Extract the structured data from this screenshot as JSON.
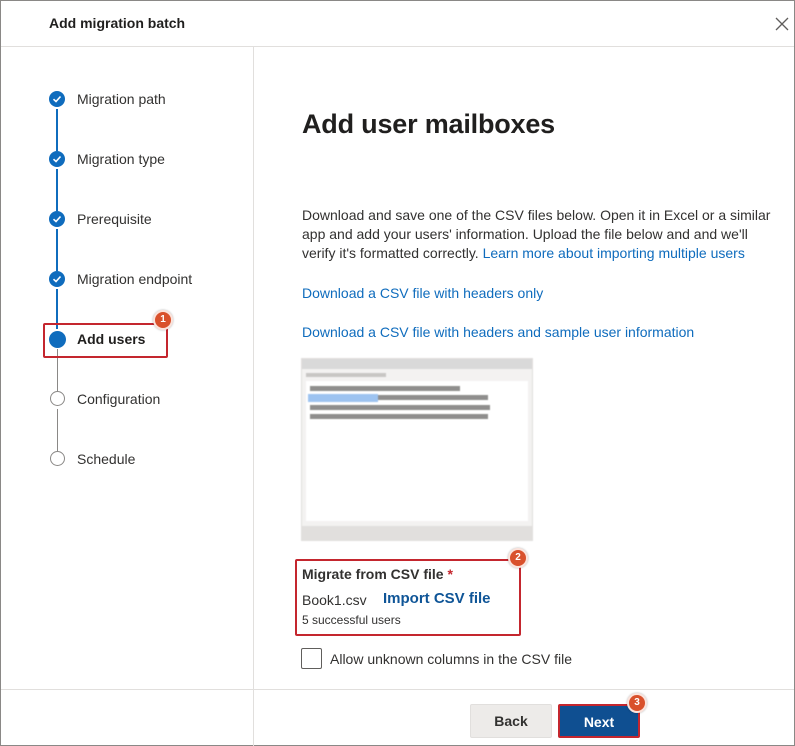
{
  "dialog": {
    "title": "Add migration batch",
    "close_icon": "close-icon"
  },
  "steps": [
    {
      "label": "Migration path",
      "state": "done"
    },
    {
      "label": "Migration type",
      "state": "done"
    },
    {
      "label": "Prerequisite",
      "state": "done"
    },
    {
      "label": "Migration endpoint",
      "state": "done"
    },
    {
      "label": "Add users",
      "state": "current"
    },
    {
      "label": "Configuration",
      "state": "pending"
    },
    {
      "label": "Schedule",
      "state": "pending"
    }
  ],
  "annotations": {
    "badge1": "1",
    "badge2": "2",
    "badge3": "3"
  },
  "main": {
    "title": "Add user mailboxes",
    "description": "Download and save one of the CSV files below. Open it in Excel or a similar app and add your users' information. Upload the file below and and we'll verify it's formatted correctly.",
    "learn_more_link": "Learn more about importing multiple users",
    "download_headers_only": "Download a CSV file with headers only",
    "download_with_sample": "Download a CSV file with headers and sample user information"
  },
  "csv_field": {
    "label": "Migrate from CSV file",
    "required_mark": "*",
    "file_name": "Book1.csv",
    "import_label": "Import CSV file",
    "status": "5 successful users"
  },
  "options": {
    "allow_unknown_columns": "Allow unknown columns in the CSV file",
    "allow_unknown_checked": false
  },
  "footer": {
    "back_label": "Back",
    "next_label": "Next"
  },
  "colors": {
    "accent": "#0f6cbd",
    "annotation_red": "#c4262e",
    "badge_orange": "#d9512c",
    "next_button": "#0f4f91"
  }
}
